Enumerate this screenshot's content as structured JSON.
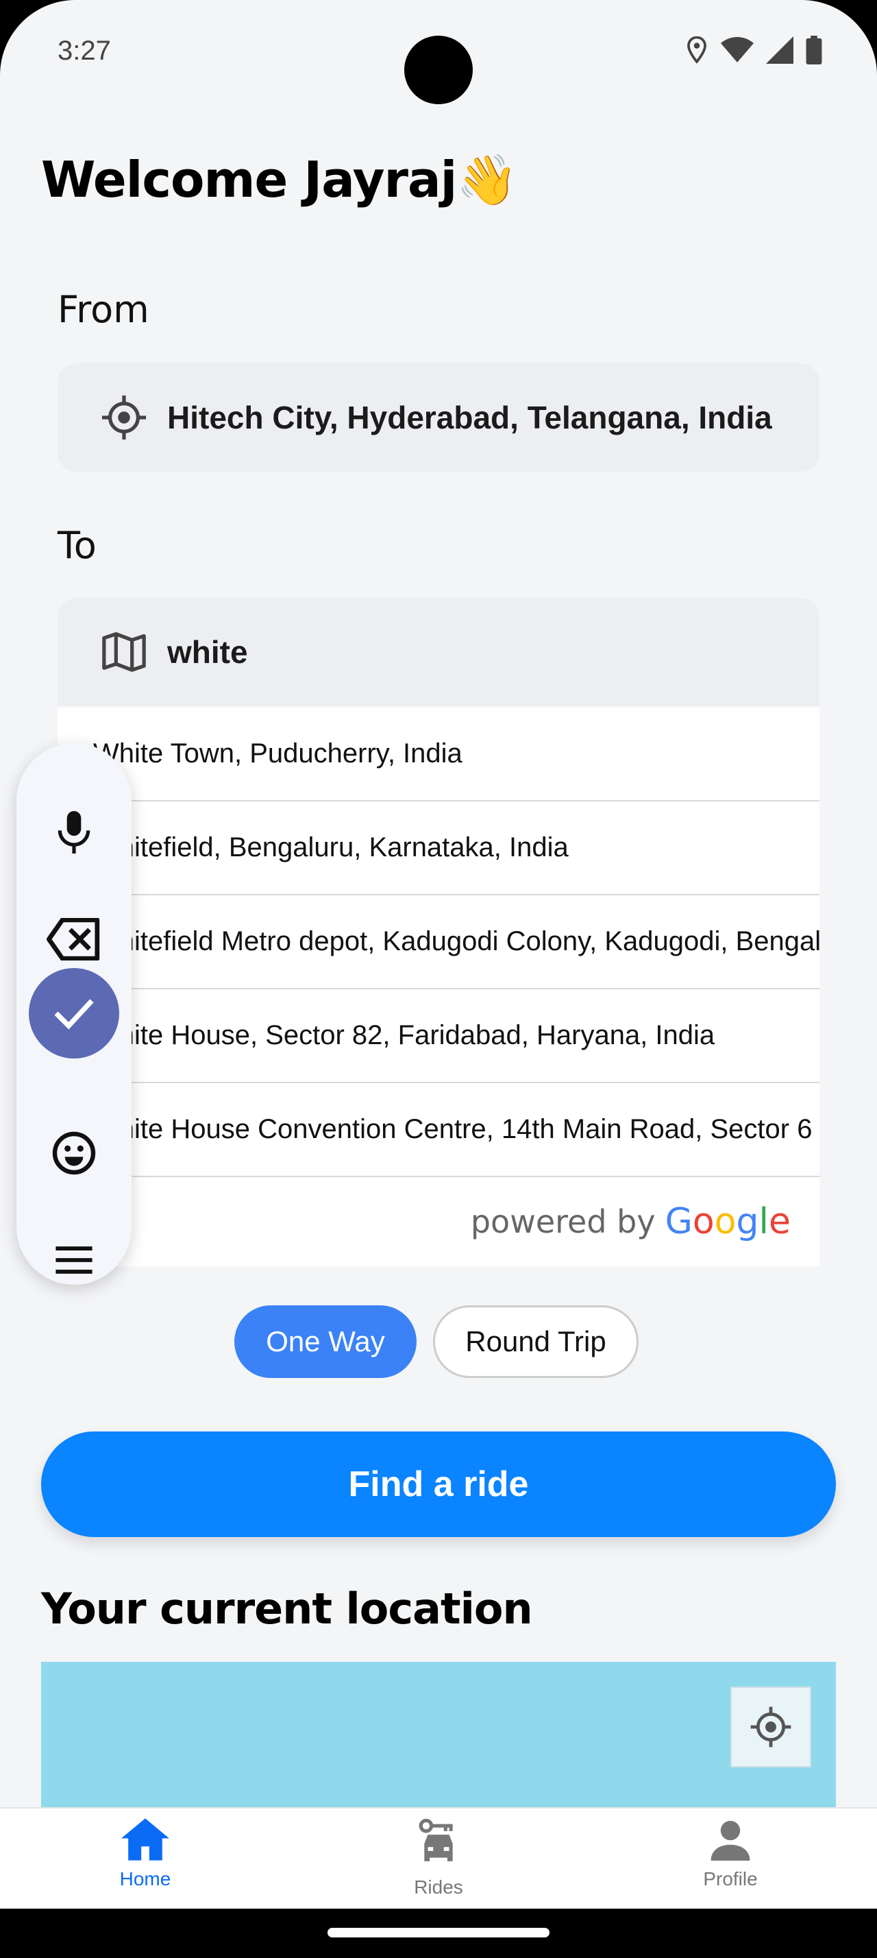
{
  "status_bar": {
    "time": "3:27"
  },
  "header": {
    "greeting": "Welcome Jayraj👋"
  },
  "from": {
    "label": "From",
    "value": "Hitech City, Hyderabad, Telangana, India"
  },
  "to": {
    "label": "To",
    "value": "white"
  },
  "suggestions": [
    "White Town, Puducherry, India",
    "Whitefield, Bengaluru, Karnataka, India",
    "Whitefield Metro depot, Kadugodi Colony, Kadugodi, Bengaluru",
    "White House, Sector 82, Faridabad, Haryana, India",
    "White House Convention Centre, 14th Main Road, Sector 6"
  ],
  "powered_by": {
    "text": "powered by",
    "brand": "Google"
  },
  "trip_type": {
    "one_way": "One Way",
    "round_trip": "Round Trip"
  },
  "find_ride": "Find a ride",
  "current_location": {
    "title": "Your current location"
  },
  "bottom_nav": {
    "home": "Home",
    "rides": "Rides",
    "profile": "Profile"
  },
  "colors": {
    "accent": "#0a84ff",
    "chip_active": "#3b82f6",
    "map": "#8fd9ec",
    "nav_active": "#0a6cf5"
  }
}
